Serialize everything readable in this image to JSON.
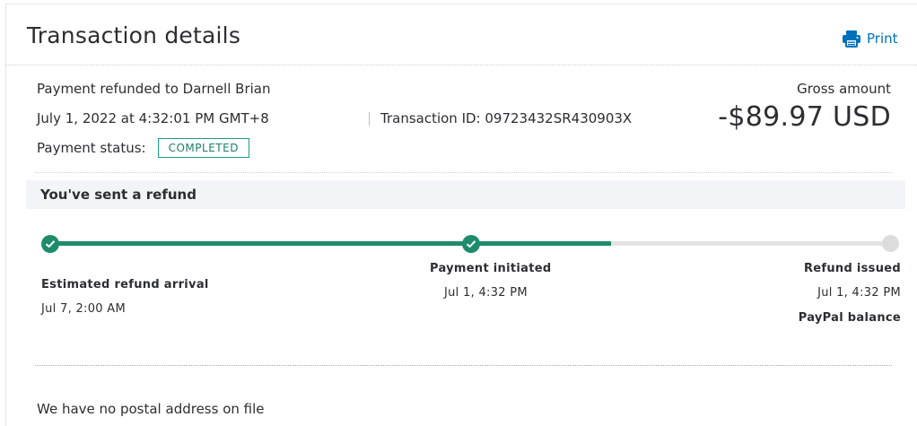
{
  "header": {
    "title": "Transaction details",
    "print_label": "Print"
  },
  "transaction": {
    "refund_to": "Payment refunded to Darnell Brian",
    "date_time": "July 1, 2022 at 4:32:01 PM GMT+8",
    "transaction_id": "Transaction ID: 09723432SR430903X",
    "status_label": "Payment status:",
    "status_value": "COMPLETED",
    "gross_label": "Gross amount",
    "gross_amount": "-$89.97 USD"
  },
  "refund": {
    "banner": "You've sent a refund",
    "steps": [
      {
        "title": "Estimated refund arrival",
        "time": "Jul 7, 2:00 AM",
        "state": "done"
      },
      {
        "title": "Payment initiated",
        "time": "Jul 1, 4:32 PM",
        "state": "done"
      },
      {
        "title": "Refund issued",
        "time": "Jul 1, 4:32 PM",
        "detail": "PayPal balance",
        "state": "pending"
      }
    ]
  },
  "footer": {
    "postal_note": "We have no postal address on file"
  },
  "colors": {
    "accent": "#0070ba",
    "success": "#1e8c6b",
    "track": "#e3e3e3"
  },
  "icons": {
    "print": "printer-icon",
    "check": "check-icon"
  }
}
